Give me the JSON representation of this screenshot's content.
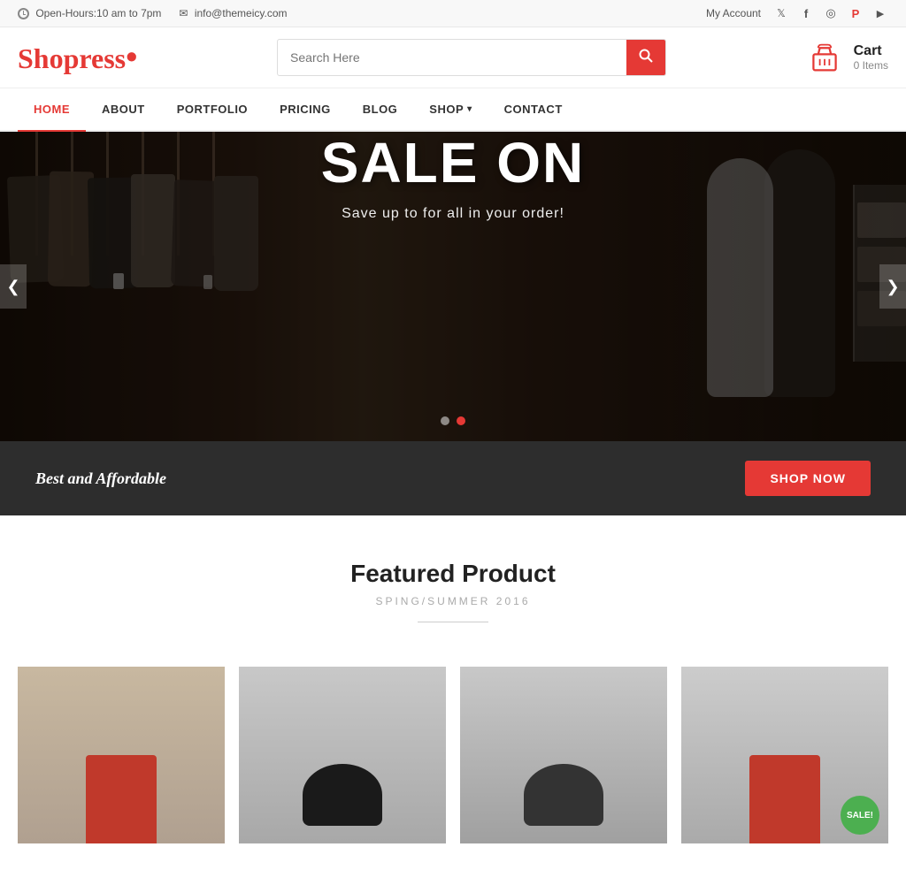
{
  "topbar": {
    "hours_icon": "clock",
    "hours_label": "Open-Hours:10 am to 7pm",
    "email_icon": "email",
    "email_label": "info@themeicy.com",
    "account_label": "My Account",
    "social": [
      {
        "name": "twitter",
        "symbol": "𝕏"
      },
      {
        "name": "facebook",
        "symbol": "f"
      },
      {
        "name": "instagram",
        "symbol": "📷"
      },
      {
        "name": "pinterest",
        "symbol": "P"
      },
      {
        "name": "youtube",
        "symbol": "▶"
      }
    ]
  },
  "header": {
    "logo_first": "Shopress",
    "logo_dot": "•",
    "search_placeholder": "Search Here",
    "search_button_label": "🔍",
    "cart_label": "Cart",
    "cart_items": "0 Items"
  },
  "nav": {
    "items": [
      {
        "label": "HOME",
        "active": true,
        "has_dropdown": false
      },
      {
        "label": "ABOUT",
        "active": false,
        "has_dropdown": false
      },
      {
        "label": "PORTFOLIO",
        "active": false,
        "has_dropdown": false
      },
      {
        "label": "PRICING",
        "active": false,
        "has_dropdown": false
      },
      {
        "label": "BLOG",
        "active": false,
        "has_dropdown": false
      },
      {
        "label": "SHOP",
        "active": false,
        "has_dropdown": true
      },
      {
        "label": "CONTACT",
        "active": false,
        "has_dropdown": false
      }
    ]
  },
  "hero": {
    "slide_title": "SALE ON",
    "slide_subtitle": "Save up to for all in your order!",
    "dots": [
      {
        "active": false
      },
      {
        "active": true
      }
    ],
    "prev_arrow": "❮",
    "next_arrow": "❯"
  },
  "promo": {
    "text": "Best and Affordable",
    "button_label": "Shop Now"
  },
  "featured": {
    "title": "Featured Product",
    "subtitle": "SPING/SUMMER 2016"
  },
  "products": [
    {
      "id": 1,
      "has_sale": false,
      "bg": "#c8b8a8"
    },
    {
      "id": 2,
      "has_sale": false,
      "bg": "#888"
    },
    {
      "id": 3,
      "has_sale": false,
      "bg": "#777"
    },
    {
      "id": 4,
      "has_sale": true,
      "sale_label": "SALE!",
      "bg": "#c0392b"
    }
  ]
}
